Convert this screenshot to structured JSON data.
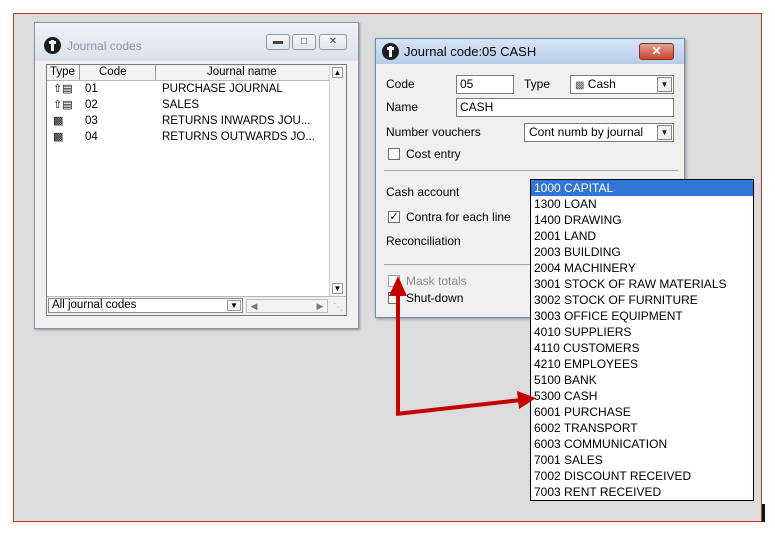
{
  "journal_codes_window": {
    "title": "Journal codes",
    "columns": [
      "Type",
      "Code",
      "Journal name"
    ],
    "rows": [
      {
        "icon": "purchase-journal-icon",
        "code": "01",
        "name": "PURCHASE JOURNAL"
      },
      {
        "icon": "sales-journal-icon",
        "code": "02",
        "name": "SALES"
      },
      {
        "icon": "returns-inwards-icon",
        "code": "03",
        "name": "RETURNS INWARDS JOU..."
      },
      {
        "icon": "returns-outwards-icon",
        "code": "04",
        "name": "RETURNS OUTWARDS JO..."
      }
    ],
    "filter_value": "All journal codes"
  },
  "journal_code_window": {
    "title": "Journal code:05 CASH",
    "code_label": "Code",
    "code_value": "05",
    "type_label": "Type",
    "type_value": "Cash",
    "name_label": "Name",
    "name_value": "CASH",
    "number_vouchers_label": "Number vouchers",
    "number_vouchers_value": "Cont numb by journal",
    "cost_entry_label": "Cost entry",
    "cash_account_label": "Cash account",
    "contra_label": "Contra for each line",
    "contra_checked": true,
    "reconciliation_label": "Reconciliation",
    "mask_totals_label": "Mask totals",
    "shut_down_label": "Shut-down"
  },
  "cash_account_options": [
    "1000 CAPITAL",
    "1300 LOAN",
    "1400 DRAWING",
    "2001 LAND",
    "2003 BUILDING",
    "2004 MACHINERY",
    "3001 STOCK OF RAW MATERIALS",
    "3002 STOCK OF FURNITURE",
    "3003 OFFICE EQUIPMENT",
    "4010 SUPPLIERS",
    "4110 CUSTOMERS",
    "4210 EMPLOYEES",
    "5100 BANK",
    "5300 CASH",
    "6001 PURCHASE",
    "6002 TRANSPORT",
    "6003 COMMUNICATION",
    "7001 SALES",
    "7002 DISCOUNT RECEIVED",
    "7003 RENT RECEIVED"
  ],
  "selected_option_index": 0,
  "colors": {
    "annotation_arrow": "#c40000",
    "selection": "#3176d6",
    "frame_border": "#c0392b"
  }
}
